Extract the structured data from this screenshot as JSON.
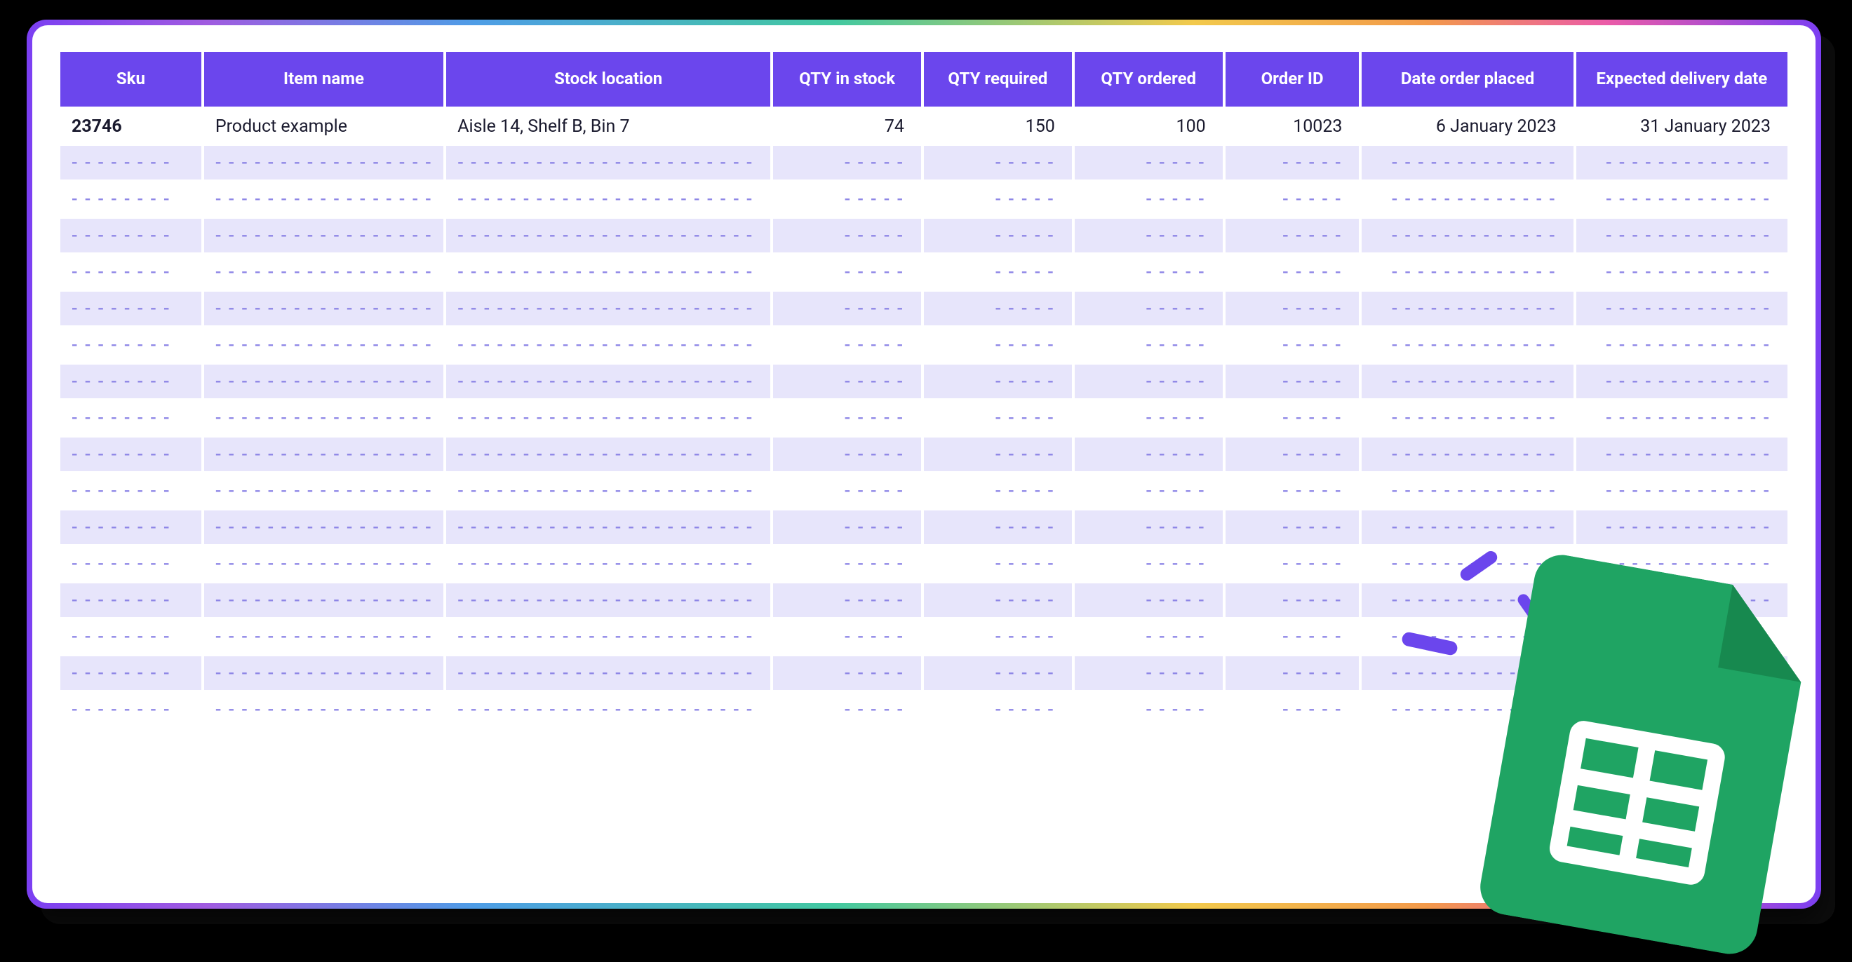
{
  "colors": {
    "header_bg": "#6b46ed",
    "row_alt_bg": "#e7e5fb",
    "sheets_green": "#1fa463"
  },
  "table": {
    "columns": [
      "Sku",
      "Item name",
      "Stock location",
      "QTY in stock",
      "QTY required",
      "QTY ordered",
      "Order ID",
      "Date order placed",
      "Expected delivery date"
    ],
    "row": {
      "sku": "23746",
      "item_name": "Product example",
      "stock_location": "Aisle 14, Shelf B, Bin 7",
      "qty_in_stock": "74",
      "qty_required": "150",
      "qty_ordered": "100",
      "order_id": "10023",
      "date_order_placed": "6 January 2023",
      "expected_delivery_date": "31 January 2023"
    },
    "placeholder_rows": 16,
    "placeholders": {
      "short": "- - - - - - - -",
      "med": "- - - - - - - - - - - - - - - - -",
      "long": "- - - - - - - - - - - - - - - - - - - - - - -",
      "tiny": "- - - - -",
      "date": "- - - - - - - - - - - - -"
    }
  },
  "icon": {
    "name": "google-sheets-icon"
  }
}
